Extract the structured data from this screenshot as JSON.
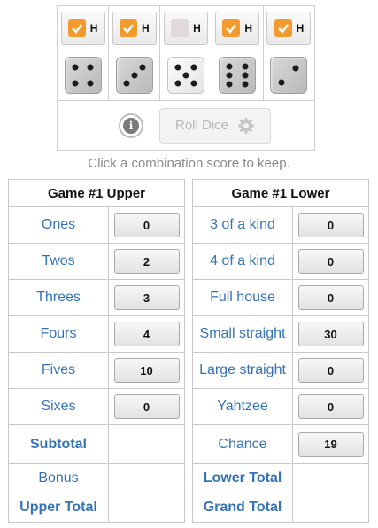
{
  "dice": [
    {
      "held": true,
      "hold_label": "H",
      "value": 4
    },
    {
      "held": true,
      "hold_label": "H",
      "value": 3
    },
    {
      "held": false,
      "hold_label": "H",
      "value": 5
    },
    {
      "held": true,
      "hold_label": "H",
      "value": 6
    },
    {
      "held": true,
      "hold_label": "H",
      "value": 2
    }
  ],
  "roll_button": {
    "label": "Roll Dice",
    "icon": "gear-icon",
    "enabled": false
  },
  "info_button": {
    "label": "i",
    "icon": "info-icon"
  },
  "hint": "Click a combination score to keep.",
  "upper": {
    "title": "Game #1 Upper",
    "rows": [
      {
        "name": "Ones",
        "score": "0"
      },
      {
        "name": "Twos",
        "score": "2"
      },
      {
        "name": "Threes",
        "score": "3"
      },
      {
        "name": "Fours",
        "score": "4"
      },
      {
        "name": "Fives",
        "score": "10"
      },
      {
        "name": "Sixes",
        "score": "0"
      }
    ],
    "subtotal_label": "Subtotal",
    "bonus_label": "Bonus",
    "total_label": "Upper Total"
  },
  "lower": {
    "title": "Game #1 Lower",
    "rows": [
      {
        "name": "3 of a kind",
        "score": "0"
      },
      {
        "name": "4 of a kind",
        "score": "0"
      },
      {
        "name": "Full house",
        "score": "0"
      },
      {
        "name": "Small straight",
        "score": "30"
      },
      {
        "name": "Large straight",
        "score": "0"
      },
      {
        "name": "Yahtzee",
        "score": "0"
      },
      {
        "name": "Chance",
        "score": "19"
      }
    ],
    "lower_total_label": "Lower Total",
    "grand_total_label": "Grand Total"
  },
  "colors": {
    "accent": "#f29a2e",
    "link": "#3473b8",
    "hint": "#8a8a8a"
  }
}
